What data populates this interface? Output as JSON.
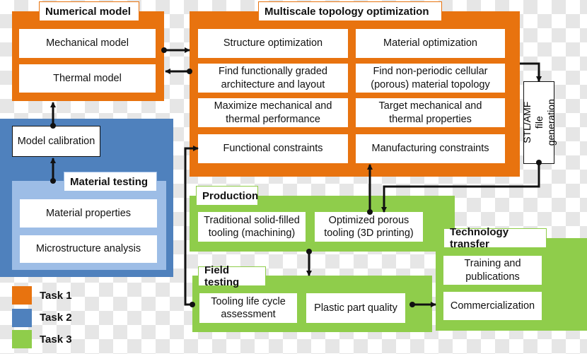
{
  "colors": {
    "task1": "#e8730f",
    "task2": "#4f81bd",
    "task3": "#8fcd4b"
  },
  "numerical_model": {
    "title": "Numerical model",
    "items": [
      "Mechanical model",
      "Thermal model"
    ]
  },
  "multiscale": {
    "title": "Multiscale topology optimization",
    "items": [
      "Structure optimization",
      "Material optimization",
      "Find functionally graded architecture and layout",
      "Find non-periodic cellular (porous) material topology",
      "Maximize mechanical and thermal performance",
      "Target mechanical and thermal properties",
      "Functional constraints",
      "Manufacturing constraints"
    ]
  },
  "stl": "STL/AMF file generation",
  "model_calibration": "Model calibration",
  "material_testing": {
    "title": "Material testing",
    "items": [
      "Material properties",
      "Microstructure analysis"
    ]
  },
  "production": {
    "title": "Production",
    "items": [
      "Traditional solid-filled tooling (machining)",
      "Optimized porous tooling (3D printing)"
    ]
  },
  "field_testing": {
    "title": "Field testing",
    "items": [
      "Tooling life cycle assessment",
      "Plastic part quality"
    ]
  },
  "technology_transfer": {
    "title": "Technology transfer",
    "items": [
      "Training and publications",
      "Commercialization"
    ]
  },
  "legend": [
    "Task 1",
    "Task 2",
    "Task 3"
  ]
}
